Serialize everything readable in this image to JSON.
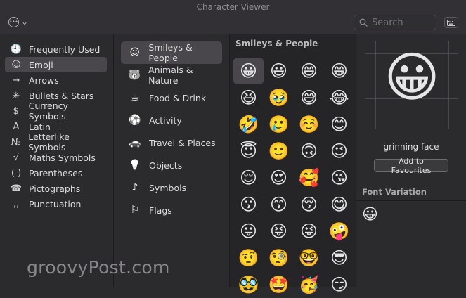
{
  "window": {
    "title": "Character Viewer"
  },
  "toolbar": {
    "action_chevron": "⌄",
    "search": {
      "placeholder": "Search",
      "value": ""
    }
  },
  "categories": [
    {
      "icon": "clock-icon",
      "glyph": "🕘",
      "label": "Frequently Used"
    },
    {
      "icon": "smiley-icon",
      "glyph": "☺",
      "label": "Emoji",
      "selected": true
    },
    {
      "icon": "arrow-icon",
      "glyph": "→",
      "label": "Arrows"
    },
    {
      "icon": "asterisk-icon",
      "glyph": "✳",
      "label": "Bullets & Stars"
    },
    {
      "icon": "dollar-icon",
      "glyph": "$",
      "label": "Currency Symbols"
    },
    {
      "icon": "latin-a-icon",
      "glyph": "A",
      "label": "Latin"
    },
    {
      "icon": "numero-icon",
      "glyph": "№",
      "label": "Letterlike Symbols"
    },
    {
      "icon": "sqrt-icon",
      "glyph": "√",
      "label": "Maths Symbols"
    },
    {
      "icon": "parentheses-icon",
      "glyph": "( )",
      "label": "Parentheses"
    },
    {
      "icon": "pictograph-icon",
      "glyph": "☎",
      "label": "Pictographs"
    },
    {
      "icon": "punctuation-icon",
      "glyph": ",,",
      "label": "Punctuation"
    }
  ],
  "subcategories": [
    {
      "icon": "smiley-outline-icon",
      "glyph": "☺",
      "label": "Smileys & People",
      "selected": true
    },
    {
      "icon": "bear-icon",
      "glyph": "🐻",
      "label": "Animals & Nature"
    },
    {
      "icon": "cup-icon",
      "glyph": "☕",
      "label": "Food & Drink"
    },
    {
      "icon": "soccer-ball-icon",
      "glyph": "⚽",
      "label": "Activity"
    },
    {
      "icon": "car-icon",
      "glyph": "🚗",
      "label": "Travel & Places"
    },
    {
      "icon": "lightbulb-icon",
      "glyph": "💡",
      "label": "Objects"
    },
    {
      "icon": "symbols-icon",
      "glyph": "♪",
      "label": "Symbols"
    },
    {
      "icon": "flag-icon",
      "glyph": "⚐",
      "label": "Flags"
    }
  ],
  "grid": {
    "heading": "Smileys & People",
    "emojis": [
      "😀",
      "😃",
      "😄",
      "😁",
      "😆",
      "🥹",
      "😅",
      "😂",
      "🤣",
      "🥲",
      "☺️",
      "😊",
      "😇",
      "🙂",
      "🙃",
      "😉",
      "😌",
      "😍",
      "🥰",
      "😘",
      "😗",
      "😙",
      "😚",
      "😋",
      "😛",
      "😝",
      "😜",
      "🤪",
      "🤨",
      "🧐",
      "🤓",
      "😎",
      "🥸",
      "🤩",
      "🥳",
      "😏"
    ],
    "selected_index": 0
  },
  "detail": {
    "preview": "😀",
    "name": "grinning face",
    "favourite_button": "Add to Favourites",
    "font_variation_label": "Font Variation",
    "font_variations": [
      "😀"
    ]
  },
  "watermark": "groovyPost.com",
  "colors": {
    "background": "#2b2a2d",
    "selection": "#49474b",
    "text": "#dcdcdc"
  }
}
